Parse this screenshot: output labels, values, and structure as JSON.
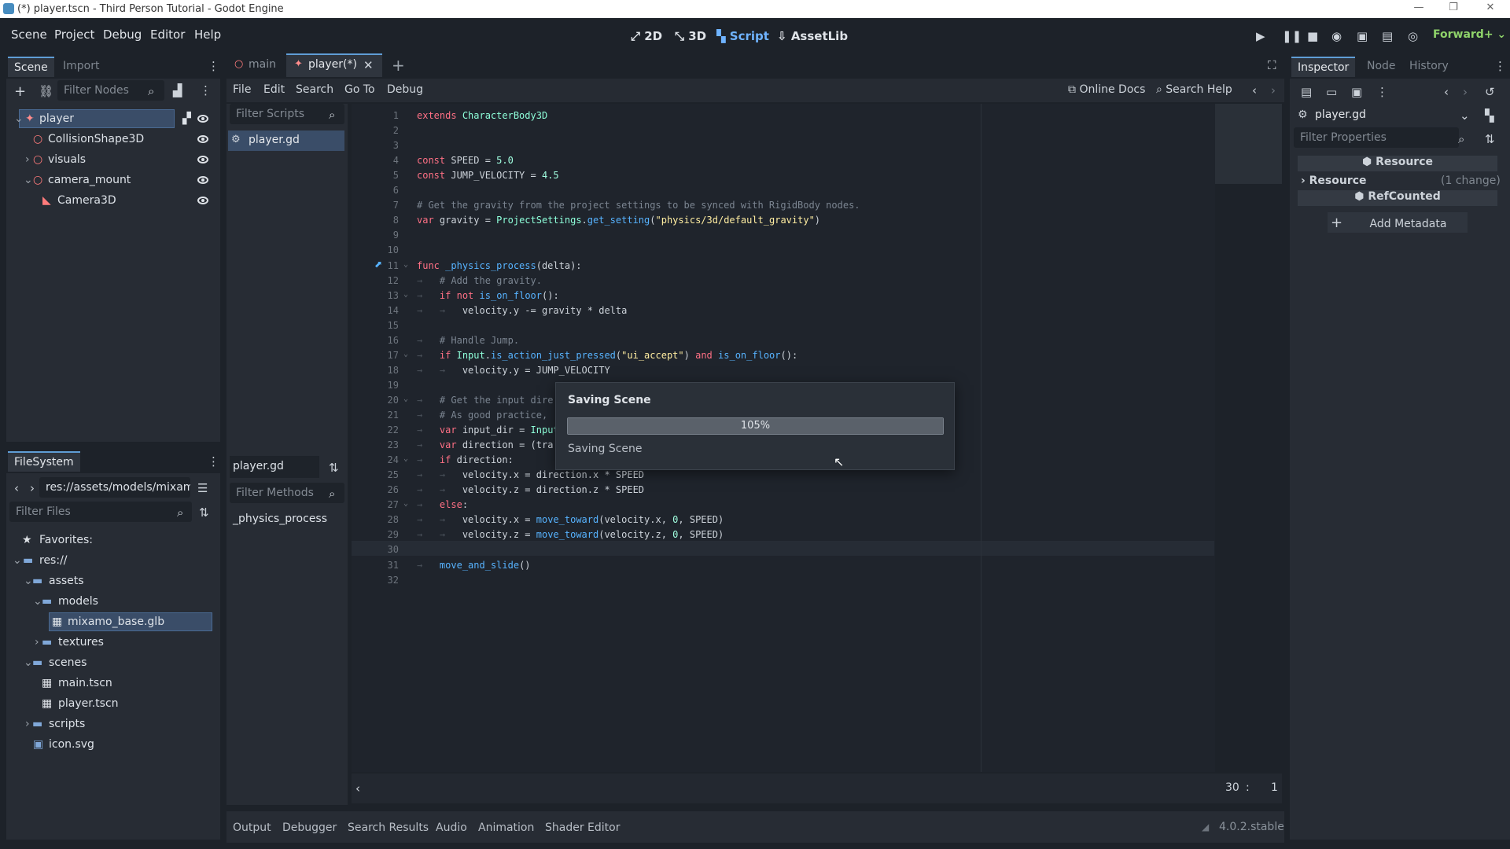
{
  "window": {
    "title": "(*) player.tscn - Third Person Tutorial - Godot Engine"
  },
  "menu": [
    "Scene",
    "Project",
    "Debug",
    "Editor",
    "Help"
  ],
  "modes": [
    {
      "label": "2D"
    },
    {
      "label": "3D"
    },
    {
      "label": "Script",
      "active": true
    },
    {
      "label": "AssetLib"
    }
  ],
  "renderer": "Forward+",
  "scene_dock": {
    "tabs": [
      "Scene",
      "Import"
    ],
    "filter_placeholder": "Filter Nodes",
    "nodes": [
      {
        "label": "player",
        "selected": true
      },
      {
        "label": "CollisionShape3D"
      },
      {
        "label": "visuals"
      },
      {
        "label": "camera_mount"
      },
      {
        "label": "Camera3D"
      }
    ]
  },
  "filesystem": {
    "tab": "FileSystem",
    "path": "res://assets/models/mixam",
    "filter_placeholder": "Filter Files",
    "favorites": "Favorites:",
    "items": [
      {
        "label": "res://"
      },
      {
        "label": "assets"
      },
      {
        "label": "models"
      },
      {
        "label": "mixamo_base.glb",
        "selected": true
      },
      {
        "label": "textures"
      },
      {
        "label": "scenes"
      },
      {
        "label": "main.tscn"
      },
      {
        "label": "player.tscn"
      },
      {
        "label": "scripts"
      },
      {
        "label": "icon.svg"
      }
    ]
  },
  "editor_tabs": [
    {
      "label": "main"
    },
    {
      "label": "player(*)",
      "active": true
    }
  ],
  "script_menu": [
    "File",
    "Edit",
    "Search",
    "Go To",
    "Debug"
  ],
  "script_toolbar": {
    "online_docs": "Online Docs",
    "search_help": "Search Help"
  },
  "scripts_panel": {
    "filter_placeholder": "Filter Scripts",
    "items": [
      "player.gd"
    ],
    "current": "player.gd",
    "methods_placeholder": "Filter Methods",
    "methods": [
      "_physics_process"
    ]
  },
  "code_lines": [
    "extends CharacterBody3D",
    "",
    "",
    "const SPEED = 5.0",
    "const JUMP_VELOCITY = 4.5",
    "",
    "# Get the gravity from the project settings to be synced with RigidBody nodes.",
    "var gravity = ProjectSettings.get_setting(\"physics/3d/default_gravity\")",
    "",
    "",
    "func _physics_process(delta):",
    "\t# Add the gravity.",
    "\tif not is_on_floor():",
    "\t\tvelocity.y -= gravity * delta",
    "",
    "\t# Handle Jump.",
    "\tif Input.is_action_just_pressed(\"ui_accept\") and is_on_floor():",
    "\t\tvelocity.y = JUMP_VELOCITY",
    "",
    "\t# Get the input dire",
    "\t# As good practice, ",
    "\tvar input_dir = Input",
    "\tvar direction = (tra",
    "\tif direction:",
    "\t\tvelocity.x = direction.x * SPEED",
    "\t\tvelocity.z = direction.z * SPEED",
    "\telse:",
    "\t\tvelocity.x = move_toward(velocity.x, 0, SPEED)",
    "\t\tvelocity.z = move_toward(velocity.z, 0, SPEED)",
    "",
    "\tmove_and_slide()",
    ""
  ],
  "cursor": {
    "line": "30",
    "col": "1"
  },
  "dialog": {
    "title": "Saving Scene",
    "progress_label": "105%",
    "progress": 1.0,
    "status": "Saving Scene"
  },
  "inspector": {
    "tabs": [
      "Inspector",
      "Node",
      "History"
    ],
    "resource": "player.gd",
    "filter_placeholder": "Filter Properties",
    "section_resource": "Resource",
    "resource_row": "Resource",
    "resource_changes": "(1 change)",
    "section_refcounted": "RefCounted",
    "add_metadata": "Add Metadata"
  },
  "bottom_tabs": [
    "Output",
    "Debugger",
    "Search Results",
    "Audio",
    "Animation",
    "Shader Editor"
  ],
  "version": "4.0.2.stable"
}
